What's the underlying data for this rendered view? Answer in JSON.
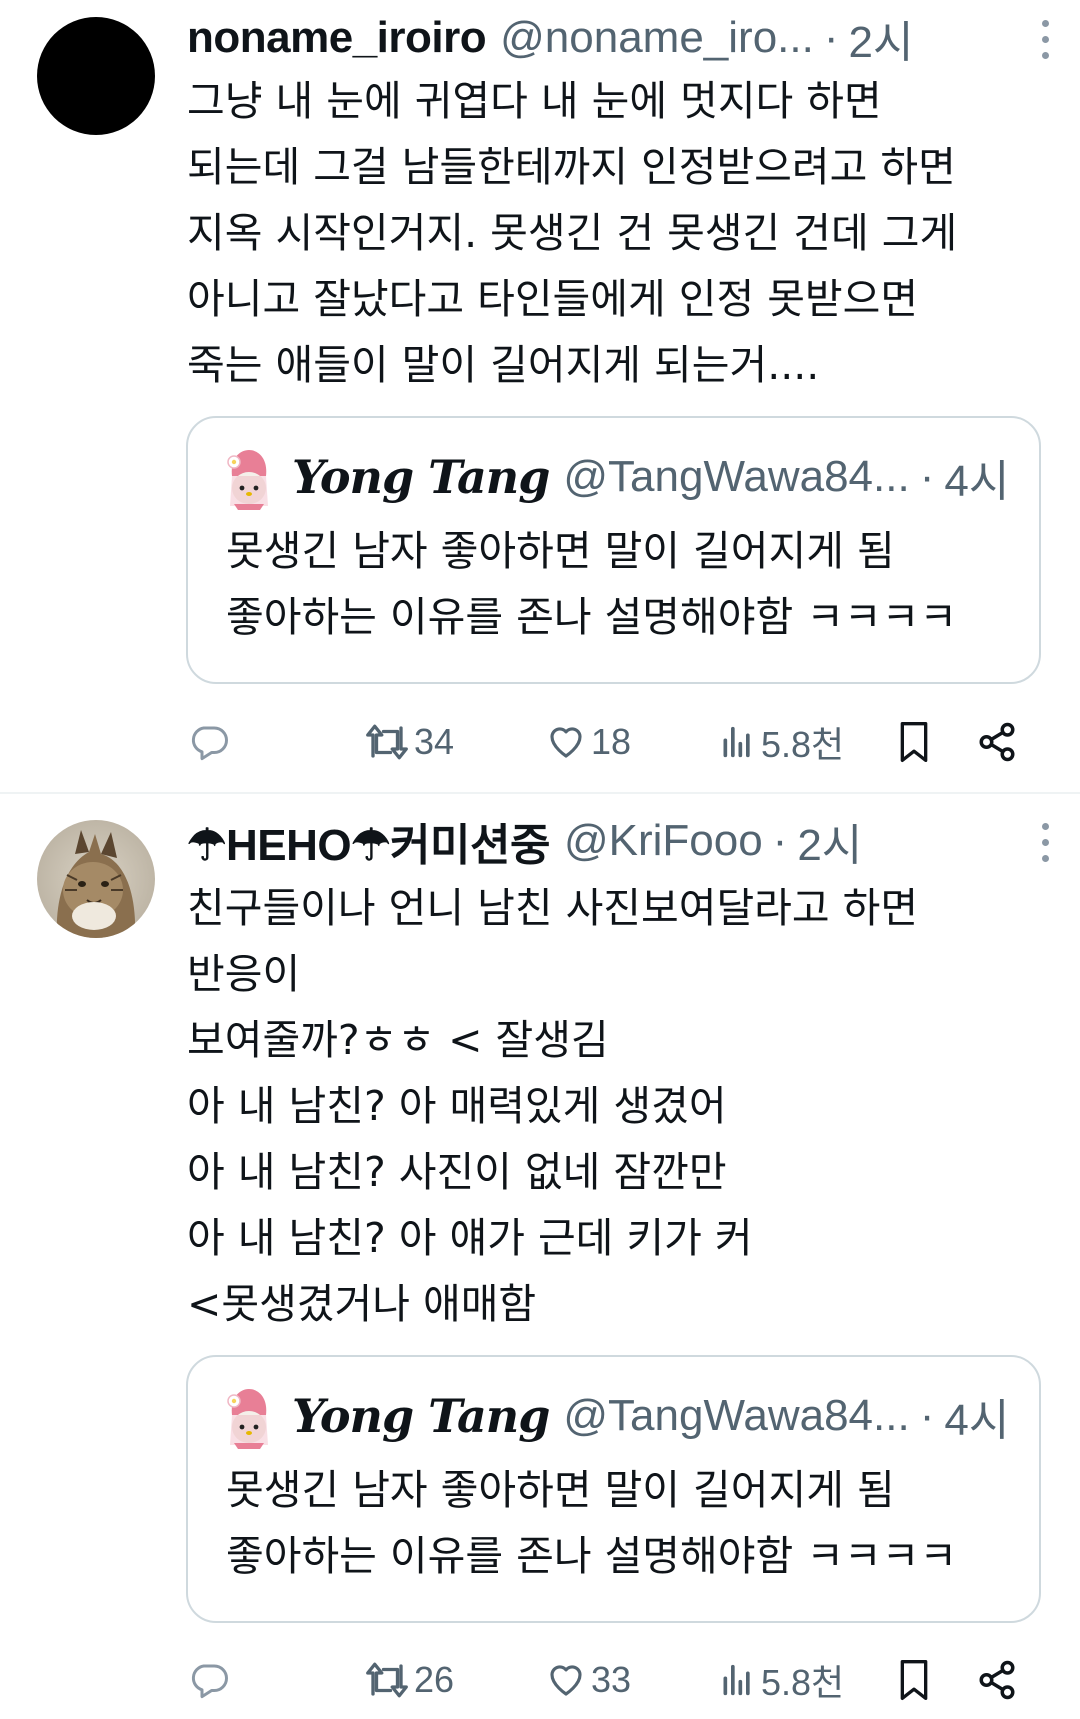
{
  "tweets": [
    {
      "author": {
        "name": "noname_iroiro",
        "handle": "@noname_iro...",
        "time": "2시",
        "avatar": "black-circle-avatar"
      },
      "separator": "·",
      "text_lines": [
        "그냥 내 눈에 귀엽다 내 눈에 멋지다 하면",
        "되는데 그걸 남들한테까지 인정받으려고 하면",
        "지옥 시작인거지. 못생긴 건 못생긴 건데 그게",
        "아니고 잘났다고 타인들에게 인정 못받으면",
        "죽는 애들이 말이 길어지게 되는거...."
      ],
      "quote": {
        "name": "Yong Tang",
        "handle": "@TangWawa84...",
        "time": "4시",
        "avatar": "pink-character-avatar",
        "text_lines": [
          "못생긴 남자 좋아하면 말이 길어지게 됨",
          "좋아하는 이유를 존나 설명해야함 ㅋㅋㅋㅋ"
        ]
      },
      "actions": {
        "reply": "",
        "retweets": "34",
        "likes": "18",
        "views": "5.8천"
      }
    },
    {
      "author": {
        "name": "☂HEHO☂커미션중",
        "handle": "@KriFooo",
        "time": "2시",
        "avatar": "lynx-photo-avatar"
      },
      "separator": "·",
      "text_lines": [
        "친구들이나 언니 남친 사진보여달라고 하면",
        "반응이",
        "보여줄까?ㅎㅎ < 잘생김",
        "아 내 남친? 아 매력있게 생겼어",
        "아 내 남친? 사진이 없네 잠깐만",
        "아 내 남친? 아 얘가 근데 키가 커",
        "<못생겼거나 애매함"
      ],
      "quote": {
        "name": "Yong Tang",
        "handle": "@TangWawa84...",
        "time": "4시",
        "avatar": "pink-character-avatar",
        "text_lines": [
          "못생긴 남자 좋아하면 말이 길어지게 됨",
          "좋아하는 이유를 존나 설명해야함 ㅋㅋㅋㅋ"
        ]
      },
      "actions": {
        "reply": "",
        "retweets": "26",
        "likes": "33",
        "views": "5.8천"
      }
    }
  ],
  "colors": {
    "text": "#0f1419",
    "secondary": "#536471",
    "border": "#cfd9de",
    "divider": "#eff3f4"
  }
}
